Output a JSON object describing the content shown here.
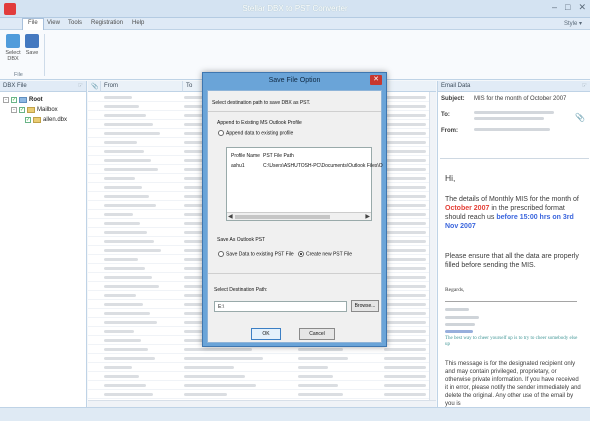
{
  "app": {
    "title": "Stellar DBX to PST Converter"
  },
  "menu": [
    "File",
    "View",
    "Tools",
    "Registration",
    "Help"
  ],
  "style_menu": "Style",
  "ribbon": {
    "select_label": "Select DBX",
    "save_label": "Save",
    "group_label": "File"
  },
  "left_pane": {
    "header": "DBX File",
    "root": "Root",
    "mailbox": "Mailbox",
    "file": "allen.dbx"
  },
  "center": {
    "col_from": "From",
    "col_to": "To"
  },
  "email_pane": {
    "header": "Email Data",
    "subject_label": "Subject:",
    "subject": "MIS for the month of October 2007",
    "to_label": "To:",
    "from_label": "From:",
    "body": {
      "greeting": "Hi,",
      "p1a": "The details of Monthly MIS for the month of",
      "p1b": "October 2007",
      "p1c": "in the prescribed format should reach us",
      "p1d": "before 15:00 hrs on 3rd Nov 2007",
      "p2": "Please ensure that all the data are properly filled before sending the MIS.",
      "regards": "Regards,",
      "tagline": "The best way to cheer yourself up is to try to cheer somebody else up",
      "disclaimer": "This message is for the designated recipient only and may contain privileged, proprietary, or otherwise private information. If you have received it in error, please notify the sender immediately and delete the original. Any other use of the email by you is"
    }
  },
  "dialog": {
    "title": "Save File Option",
    "intro": "Select destination path to save DBX as PST.",
    "append_group": "Append to Existing MS Outlook Profile",
    "append_radio": "Append data to existing profile",
    "col_profile": "Profile Name",
    "col_path": "PST File Path",
    "row_profile": "ashu1",
    "row_path": "C:\\Users\\ASHUTOSH-PC\\Documents\\Outlook Files\\O",
    "save_group": "Save As Outlook PST",
    "existing_radio": "Save Data to existing PST File",
    "new_radio": "Create new PST File",
    "dest_label": "Select Destination Path:",
    "dest_value": "E:\\",
    "browse": "Browse...",
    "ok": "OK",
    "cancel": "Cancel"
  }
}
